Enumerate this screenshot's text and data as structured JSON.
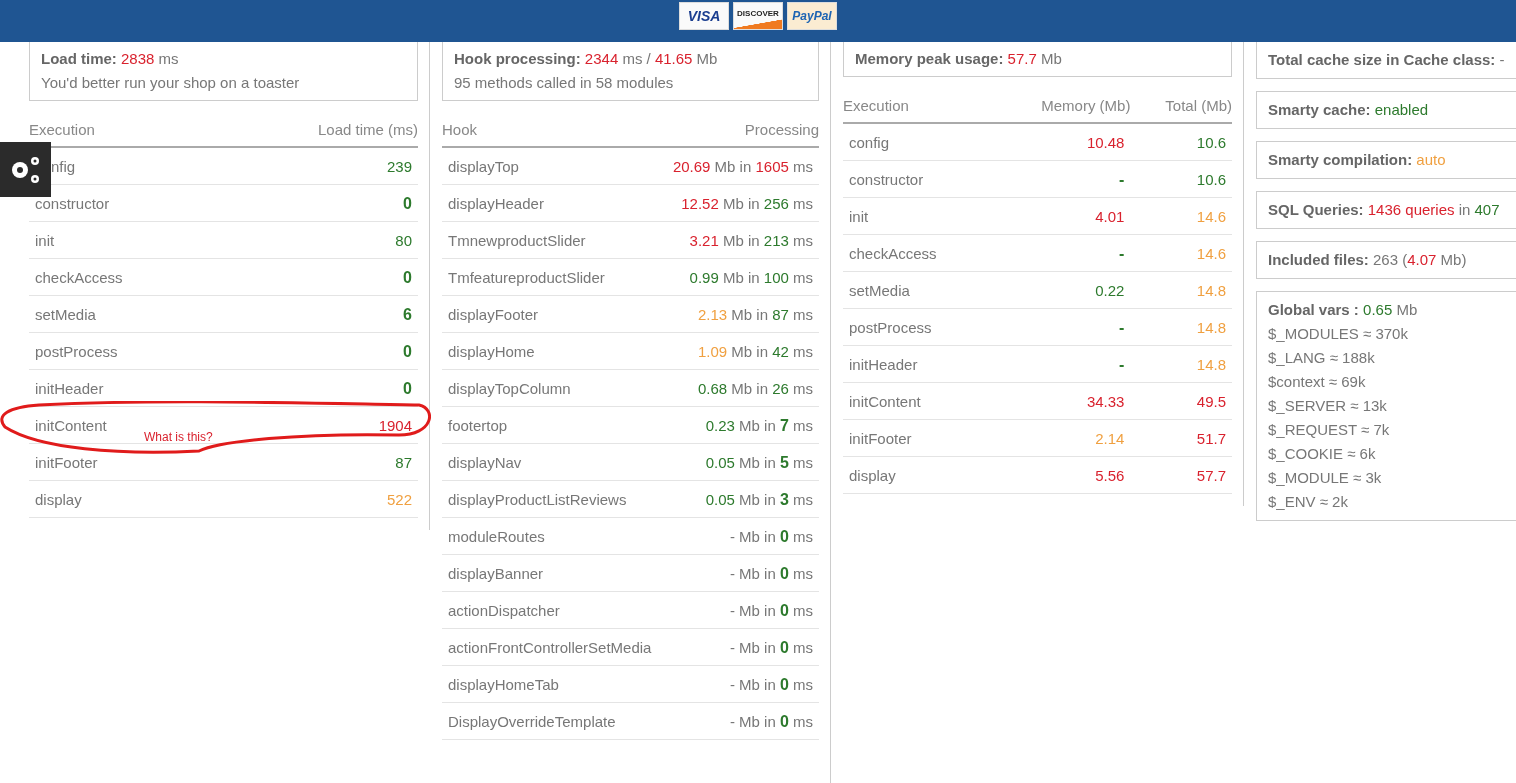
{
  "header": {
    "cards": [
      {
        "text": "VISA",
        "kind": "visa"
      },
      {
        "text": "DISCOVER",
        "kind": "discover"
      },
      {
        "text": "PayPal",
        "kind": "paypal"
      }
    ]
  },
  "columns": [
    {
      "summary": [
        [
          {
            "text": "Load time:",
            "bold": true
          },
          {
            "text": " 2838",
            "color": "#d9222e"
          },
          {
            "text": " ms"
          }
        ],
        [
          {
            "text": "You'd better run your shop on a toaster"
          }
        ]
      ],
      "table": {
        "columns": [
          "Execution",
          "Load time (ms)"
        ],
        "rows": [
          {
            "name": "nfig",
            "covered": true,
            "values": [
              [
                {
                  "text": "239",
                  "color": "#2d7a2d"
                }
              ]
            ]
          },
          {
            "name": "constructor",
            "values": [
              [
                {
                  "text": "0",
                  "color": "#2d7a2d"
                }
              ]
            ]
          },
          {
            "name": "init",
            "values": [
              [
                {
                  "text": "80",
                  "color": "#2d7a2d"
                }
              ]
            ]
          },
          {
            "name": "checkAccess",
            "values": [
              [
                {
                  "text": "0",
                  "color": "#2d7a2d"
                }
              ]
            ]
          },
          {
            "name": "setMedia",
            "values": [
              [
                {
                  "text": "6",
                  "color": "#2d7a2d"
                }
              ]
            ]
          },
          {
            "name": "postProcess",
            "values": [
              [
                {
                  "text": "0",
                  "color": "#2d7a2d"
                }
              ]
            ]
          },
          {
            "name": "initHeader",
            "values": [
              [
                {
                  "text": "0",
                  "color": "#2d7a2d"
                }
              ]
            ]
          },
          {
            "name": "initContent",
            "note": "What is this?",
            "values": [
              [
                {
                  "text": "1904",
                  "color": "#d9222e"
                }
              ]
            ]
          },
          {
            "name": "initFooter",
            "values": [
              [
                {
                  "text": "87",
                  "color": "#2d7a2d"
                }
              ]
            ]
          },
          {
            "name": "display",
            "values": [
              [
                {
                  "text": "522",
                  "color": "#f0a040"
                }
              ]
            ]
          }
        ]
      }
    },
    {
      "summary": [
        [
          {
            "text": "Hook processing:",
            "bold": true
          },
          {
            "text": " 2344",
            "color": "#d9222e"
          },
          {
            "text": " ms / "
          },
          {
            "text": "41.65",
            "color": "#d9222e"
          },
          {
            "text": " Mb"
          }
        ],
        [
          {
            "text": "95 methods called in 58 modules"
          }
        ]
      ],
      "table": {
        "columns": [
          "Hook",
          "Processing"
        ],
        "rows": [
          {
            "name": "displayTop",
            "values": [
              [
                {
                  "text": "20.69",
                  "color": "#d9222e"
                },
                {
                  "text": " Mb in "
                },
                {
                  "text": "1605",
                  "color": "#d9222e"
                },
                {
                  "text": " ms"
                }
              ]
            ]
          },
          {
            "name": "displayHeader",
            "values": [
              [
                {
                  "text": "12.52",
                  "color": "#d9222e"
                },
                {
                  "text": " Mb in "
                },
                {
                  "text": "256",
                  "color": "#2d7a2d"
                },
                {
                  "text": " ms"
                }
              ]
            ]
          },
          {
            "name": "TmnewproductSlider",
            "values": [
              [
                {
                  "text": "3.21",
                  "color": "#d9222e"
                },
                {
                  "text": " Mb in "
                },
                {
                  "text": "213",
                  "color": "#2d7a2d"
                },
                {
                  "text": " ms"
                }
              ]
            ]
          },
          {
            "name": "TmfeatureproductSlider",
            "values": [
              [
                {
                  "text": "0.99",
                  "color": "#2d7a2d"
                },
                {
                  "text": " Mb in "
                },
                {
                  "text": "100",
                  "color": "#2d7a2d"
                },
                {
                  "text": " ms"
                }
              ]
            ]
          },
          {
            "name": "displayFooter",
            "values": [
              [
                {
                  "text": "2.13",
                  "color": "#f0a040"
                },
                {
                  "text": " Mb in "
                },
                {
                  "text": "87",
                  "color": "#2d7a2d"
                },
                {
                  "text": " ms"
                }
              ]
            ]
          },
          {
            "name": "displayHome",
            "values": [
              [
                {
                  "text": "1.09",
                  "color": "#f0a040"
                },
                {
                  "text": " Mb in "
                },
                {
                  "text": "42",
                  "color": "#2d7a2d"
                },
                {
                  "text": " ms"
                }
              ]
            ]
          },
          {
            "name": "displayTopColumn",
            "values": [
              [
                {
                  "text": "0.68",
                  "color": "#2d7a2d"
                },
                {
                  "text": " Mb in "
                },
                {
                  "text": "26",
                  "color": "#2d7a2d"
                },
                {
                  "text": " ms"
                }
              ]
            ]
          },
          {
            "name": "footertop",
            "values": [
              [
                {
                  "text": "0.23",
                  "color": "#2d7a2d"
                },
                {
                  "text": " Mb in "
                },
                {
                  "text": "7",
                  "color": "#2d7a2d"
                },
                {
                  "text": " ms"
                }
              ]
            ]
          },
          {
            "name": "displayNav",
            "values": [
              [
                {
                  "text": "0.05",
                  "color": "#2d7a2d"
                },
                {
                  "text": " Mb in "
                },
                {
                  "text": "5",
                  "color": "#2d7a2d"
                },
                {
                  "text": " ms"
                }
              ]
            ]
          },
          {
            "name": "displayProductListReviews",
            "values": [
              [
                {
                  "text": "0.05",
                  "color": "#2d7a2d"
                },
                {
                  "text": " Mb in "
                },
                {
                  "text": "3",
                  "color": "#2d7a2d"
                },
                {
                  "text": " ms"
                }
              ]
            ]
          },
          {
            "name": "moduleRoutes",
            "values": [
              [
                {
                  "text": "- Mb in "
                },
                {
                  "text": "0",
                  "color": "#2d7a2d"
                },
                {
                  "text": " ms"
                }
              ]
            ]
          },
          {
            "name": "displayBanner",
            "values": [
              [
                {
                  "text": "- Mb in "
                },
                {
                  "text": "0",
                  "color": "#2d7a2d"
                },
                {
                  "text": " ms"
                }
              ]
            ]
          },
          {
            "name": "actionDispatcher",
            "values": [
              [
                {
                  "text": "- Mb in "
                },
                {
                  "text": "0",
                  "color": "#2d7a2d"
                },
                {
                  "text": " ms"
                }
              ]
            ]
          },
          {
            "name": "actionFrontControllerSetMedia",
            "values": [
              [
                {
                  "text": "- Mb in "
                },
                {
                  "text": "0",
                  "color": "#2d7a2d"
                },
                {
                  "text": " ms"
                }
              ]
            ]
          },
          {
            "name": "displayHomeTab",
            "values": [
              [
                {
                  "text": "- Mb in "
                },
                {
                  "text": "0",
                  "color": "#2d7a2d"
                },
                {
                  "text": " ms"
                }
              ]
            ]
          },
          {
            "name": "DisplayOverrideTemplate",
            "values": [
              [
                {
                  "text": "- Mb in "
                },
                {
                  "text": "0",
                  "color": "#2d7a2d"
                },
                {
                  "text": " ms"
                }
              ]
            ]
          }
        ]
      }
    },
    {
      "summary": [
        [
          {
            "text": "Memory peak usage:",
            "bold": true
          },
          {
            "text": " 57.7",
            "color": "#d9222e"
          },
          {
            "text": " Mb"
          }
        ]
      ],
      "table": {
        "columns": [
          "Execution",
          "Memory (Mb)",
          "Total (Mb)"
        ],
        "rows": [
          {
            "name": "config",
            "values": [
              [
                {
                  "text": "10.48",
                  "color": "#d9222e"
                }
              ],
              [
                {
                  "text": "10.6",
                  "color": "#2d7a2d"
                }
              ]
            ]
          },
          {
            "name": "constructor",
            "values": [
              [
                {
                  "text": "-",
                  "color": "#2d7a2d"
                }
              ],
              [
                {
                  "text": "10.6",
                  "color": "#2d7a2d"
                }
              ]
            ]
          },
          {
            "name": "init",
            "values": [
              [
                {
                  "text": "4.01",
                  "color": "#d9222e"
                }
              ],
              [
                {
                  "text": "14.6",
                  "color": "#f0a040"
                }
              ]
            ]
          },
          {
            "name": "checkAccess",
            "values": [
              [
                {
                  "text": "-",
                  "color": "#2d7a2d"
                }
              ],
              [
                {
                  "text": "14.6",
                  "color": "#f0a040"
                }
              ]
            ]
          },
          {
            "name": "setMedia",
            "values": [
              [
                {
                  "text": "0.22",
                  "color": "#2d7a2d"
                }
              ],
              [
                {
                  "text": "14.8",
                  "color": "#f0a040"
                }
              ]
            ]
          },
          {
            "name": "postProcess",
            "values": [
              [
                {
                  "text": "-",
                  "color": "#2d7a2d"
                }
              ],
              [
                {
                  "text": "14.8",
                  "color": "#f0a040"
                }
              ]
            ]
          },
          {
            "name": "initHeader",
            "values": [
              [
                {
                  "text": "-",
                  "color": "#2d7a2d"
                }
              ],
              [
                {
                  "text": "14.8",
                  "color": "#f0a040"
                }
              ]
            ]
          },
          {
            "name": "initContent",
            "values": [
              [
                {
                  "text": "34.33",
                  "color": "#d9222e"
                }
              ],
              [
                {
                  "text": "49.5",
                  "color": "#d9222e"
                }
              ]
            ]
          },
          {
            "name": "initFooter",
            "values": [
              [
                {
                  "text": "2.14",
                  "color": "#f0a040"
                }
              ],
              [
                {
                  "text": "51.7",
                  "color": "#d9222e"
                }
              ]
            ]
          },
          {
            "name": "display",
            "values": [
              [
                {
                  "text": "5.56",
                  "color": "#d9222e"
                }
              ],
              [
                {
                  "text": "57.7",
                  "color": "#d9222e"
                }
              ]
            ]
          }
        ]
      }
    },
    {
      "boxes": [
        [
          [
            {
              "text": "Total cache size in Cache class:",
              "bold": true
            },
            {
              "text": " -"
            }
          ]
        ],
        [
          [
            {
              "text": "Smarty cache:",
              "bold": true
            },
            {
              "text": " enabled",
              "color": "#2d7a2d"
            }
          ]
        ],
        [
          [
            {
              "text": "Smarty compilation:",
              "bold": true
            },
            {
              "text": " auto",
              "color": "#f0a040"
            }
          ]
        ],
        [
          [
            {
              "text": "SQL Queries:",
              "bold": true
            },
            {
              "text": " 1436 queries",
              "color": "#d9222e"
            },
            {
              "text": " in "
            },
            {
              "text": "407",
              "color": "#2d7a2d"
            }
          ]
        ],
        [
          [
            {
              "text": "Included files:",
              "bold": true
            },
            {
              "text": " 263 ("
            },
            {
              "text": "4.07",
              "color": "#d9222e"
            },
            {
              "text": " Mb)"
            }
          ]
        ],
        [
          [
            {
              "text": "Global vars :",
              "bold": true
            },
            {
              "text": " 0.65",
              "color": "#2d7a2d"
            },
            {
              "text": " Mb"
            }
          ],
          [
            {
              "text": "$_MODULES ≈ 370k"
            }
          ],
          [
            {
              "text": "$_LANG ≈ 188k"
            }
          ],
          [
            {
              "text": "$context ≈ 69k"
            }
          ],
          [
            {
              "text": "$_SERVER ≈ 13k"
            }
          ],
          [
            {
              "text": "$_REQUEST ≈ 7k"
            }
          ],
          [
            {
              "text": "$_COOKIE ≈ 6k"
            }
          ],
          [
            {
              "text": "$_MODULE ≈ 3k"
            }
          ],
          [
            {
              "text": "$_ENV ≈ 2k"
            }
          ]
        ]
      ]
    }
  ]
}
